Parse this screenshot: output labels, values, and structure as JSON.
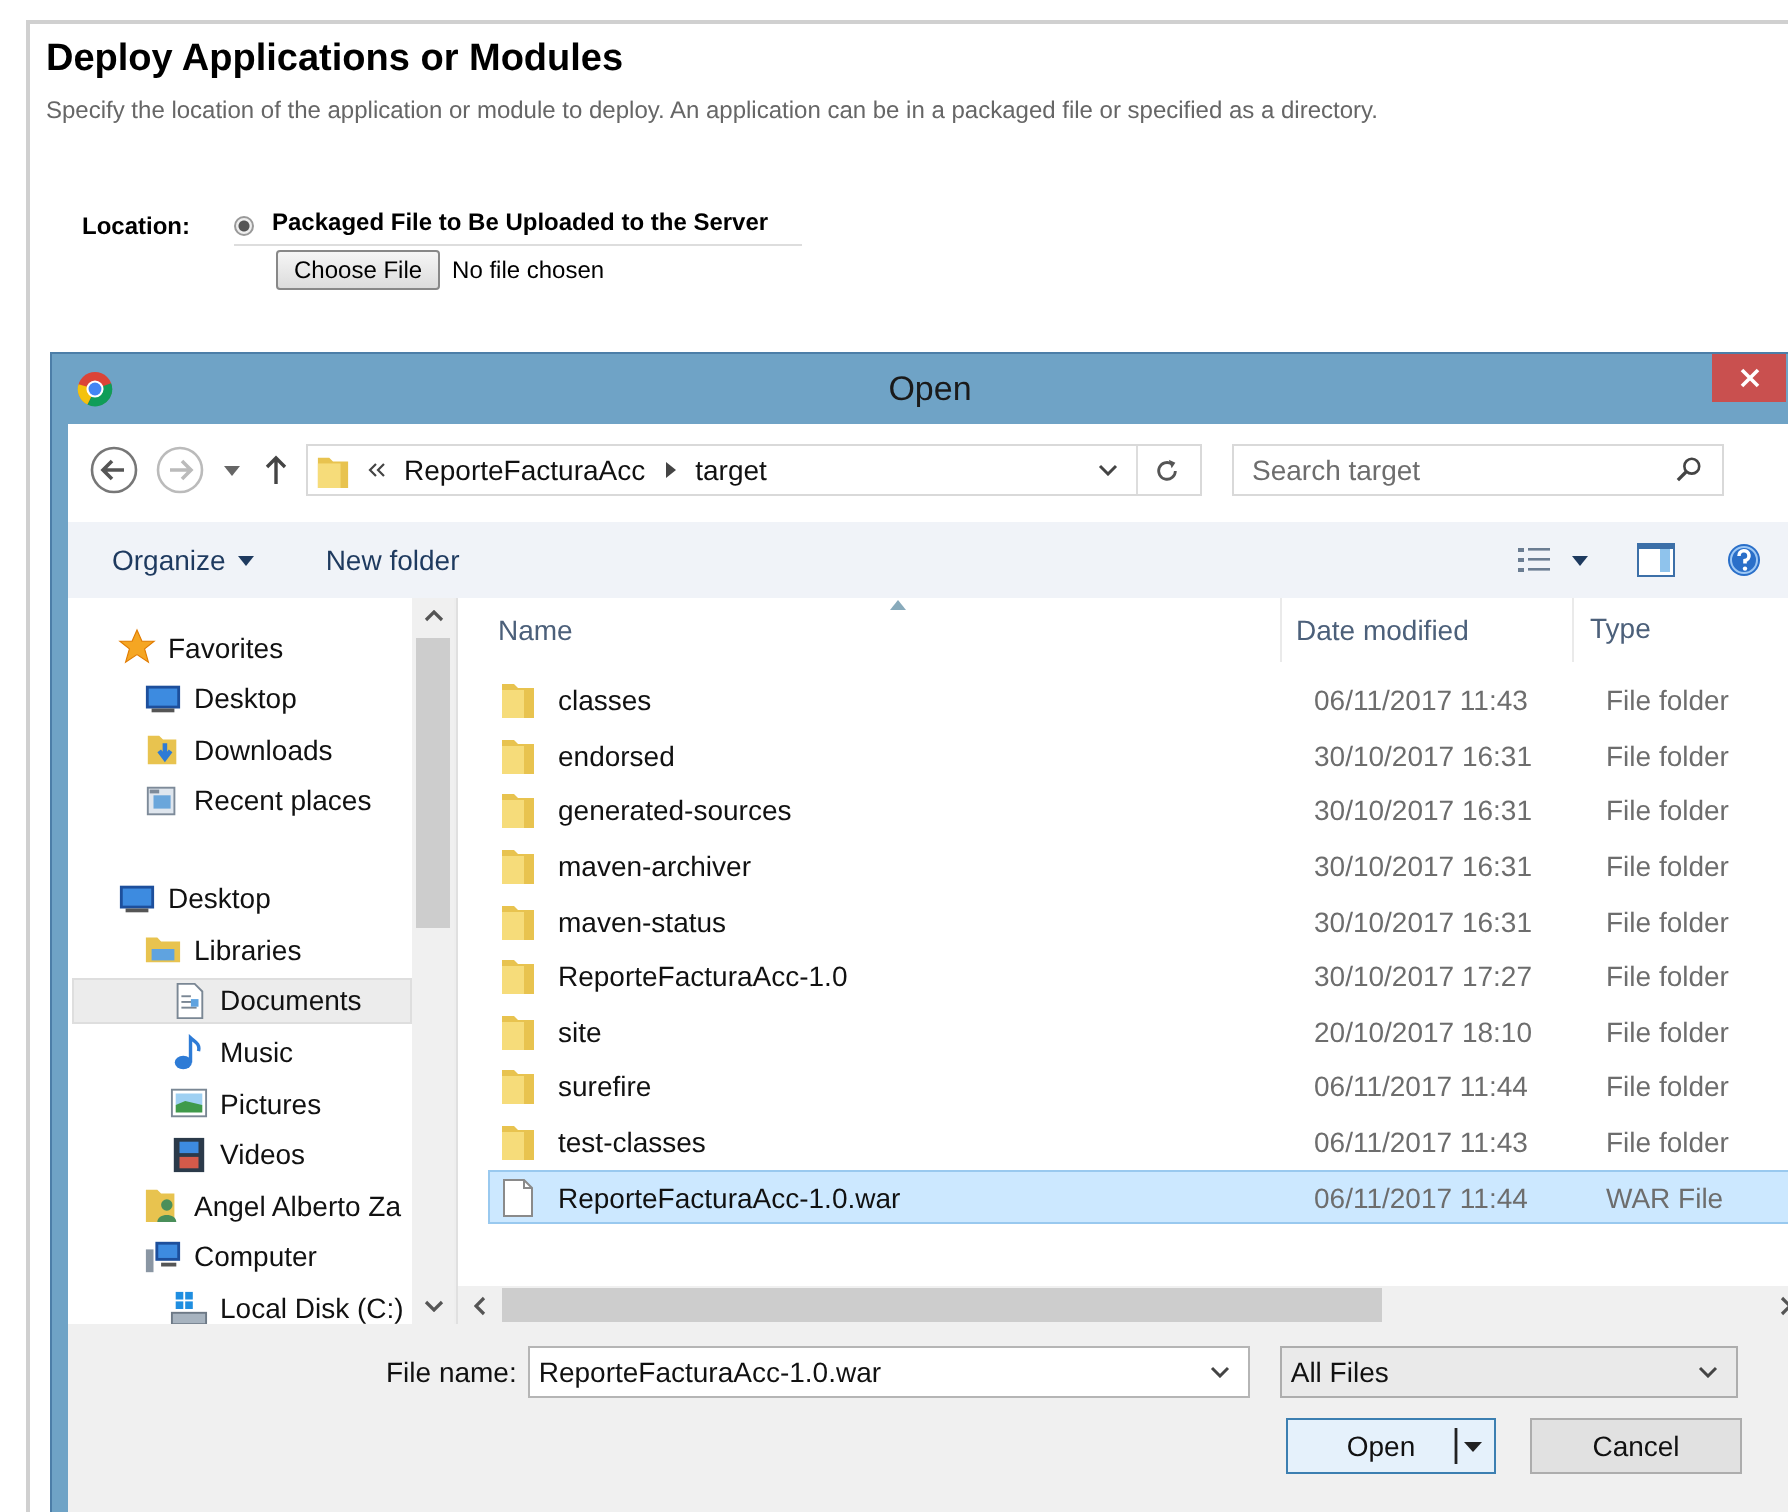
{
  "page": {
    "title": "Deploy Applications or Modules",
    "description": "Specify the location of the application or module to deploy. An application can be in a packaged file or specified as a directory.",
    "location_label": "Location:",
    "location_option": {
      "label": "Packaged File to Be Uploaded to the Server",
      "selected": true
    },
    "choose_file": "Choose File",
    "file_status": "No file chosen"
  },
  "dialog": {
    "title": "Open",
    "breadcrumb": [
      "ReporteFacturaAcc",
      "target"
    ],
    "search": {
      "placeholder": "Search target"
    },
    "toolbar": {
      "organize": "Organize",
      "new_folder": "New folder"
    },
    "nav_pane": [
      {
        "label": "Favorites",
        "kind": "star",
        "selected": false,
        "children": [
          {
            "label": "Desktop",
            "kind": "desktop",
            "selected": false
          },
          {
            "label": "Downloads",
            "kind": "downloads",
            "selected": false
          },
          {
            "label": "Recent places",
            "kind": "recent",
            "selected": false
          }
        ]
      },
      {
        "label": "Desktop",
        "kind": "desktop",
        "selected": false,
        "children": [
          {
            "label": "Libraries",
            "kind": "libraries",
            "selected": false,
            "children": [
              {
                "label": "Documents",
                "kind": "documents",
                "selected": true
              },
              {
                "label": "Music",
                "kind": "music",
                "selected": false
              },
              {
                "label": "Pictures",
                "kind": "pictures",
                "selected": false
              },
              {
                "label": "Videos",
                "kind": "videos",
                "selected": false
              }
            ]
          },
          {
            "label": "Angel Alberto Za",
            "kind": "user",
            "selected": false
          },
          {
            "label": "Computer",
            "kind": "computer",
            "selected": false,
            "children": [
              {
                "label": "Local Disk (C:)",
                "kind": "disk",
                "selected": false
              }
            ]
          }
        ]
      }
    ],
    "columns": [
      "Name",
      "Date modified",
      "Type"
    ],
    "files": [
      {
        "name": "classes",
        "date": "06/11/2017 11:43",
        "type": "File folder",
        "kind": "folder",
        "selected": false
      },
      {
        "name": "endorsed",
        "date": "30/10/2017 16:31",
        "type": "File folder",
        "kind": "folder",
        "selected": false
      },
      {
        "name": "generated-sources",
        "date": "30/10/2017 16:31",
        "type": "File folder",
        "kind": "folder",
        "selected": false
      },
      {
        "name": "maven-archiver",
        "date": "30/10/2017 16:31",
        "type": "File folder",
        "kind": "folder",
        "selected": false
      },
      {
        "name": "maven-status",
        "date": "30/10/2017 16:31",
        "type": "File folder",
        "kind": "folder",
        "selected": false
      },
      {
        "name": "ReporteFacturaAcc-1.0",
        "date": "30/10/2017 17:27",
        "type": "File folder",
        "kind": "folder",
        "selected": false
      },
      {
        "name": "site",
        "date": "20/10/2017 18:10",
        "type": "File folder",
        "kind": "folder",
        "selected": false
      },
      {
        "name": "surefire",
        "date": "06/11/2017 11:44",
        "type": "File folder",
        "kind": "folder",
        "selected": false
      },
      {
        "name": "test-classes",
        "date": "06/11/2017 11:43",
        "type": "File folder",
        "kind": "folder",
        "selected": false
      },
      {
        "name": "ReporteFacturaAcc-1.0.war",
        "date": "06/11/2017 11:44",
        "type": "WAR File",
        "kind": "file",
        "selected": true
      }
    ],
    "file_name_label": "File name:",
    "file_name": "ReporteFacturaAcc-1.0.war",
    "filter": "All Files",
    "buttons": {
      "open": "Open",
      "cancel": "Cancel"
    }
  }
}
